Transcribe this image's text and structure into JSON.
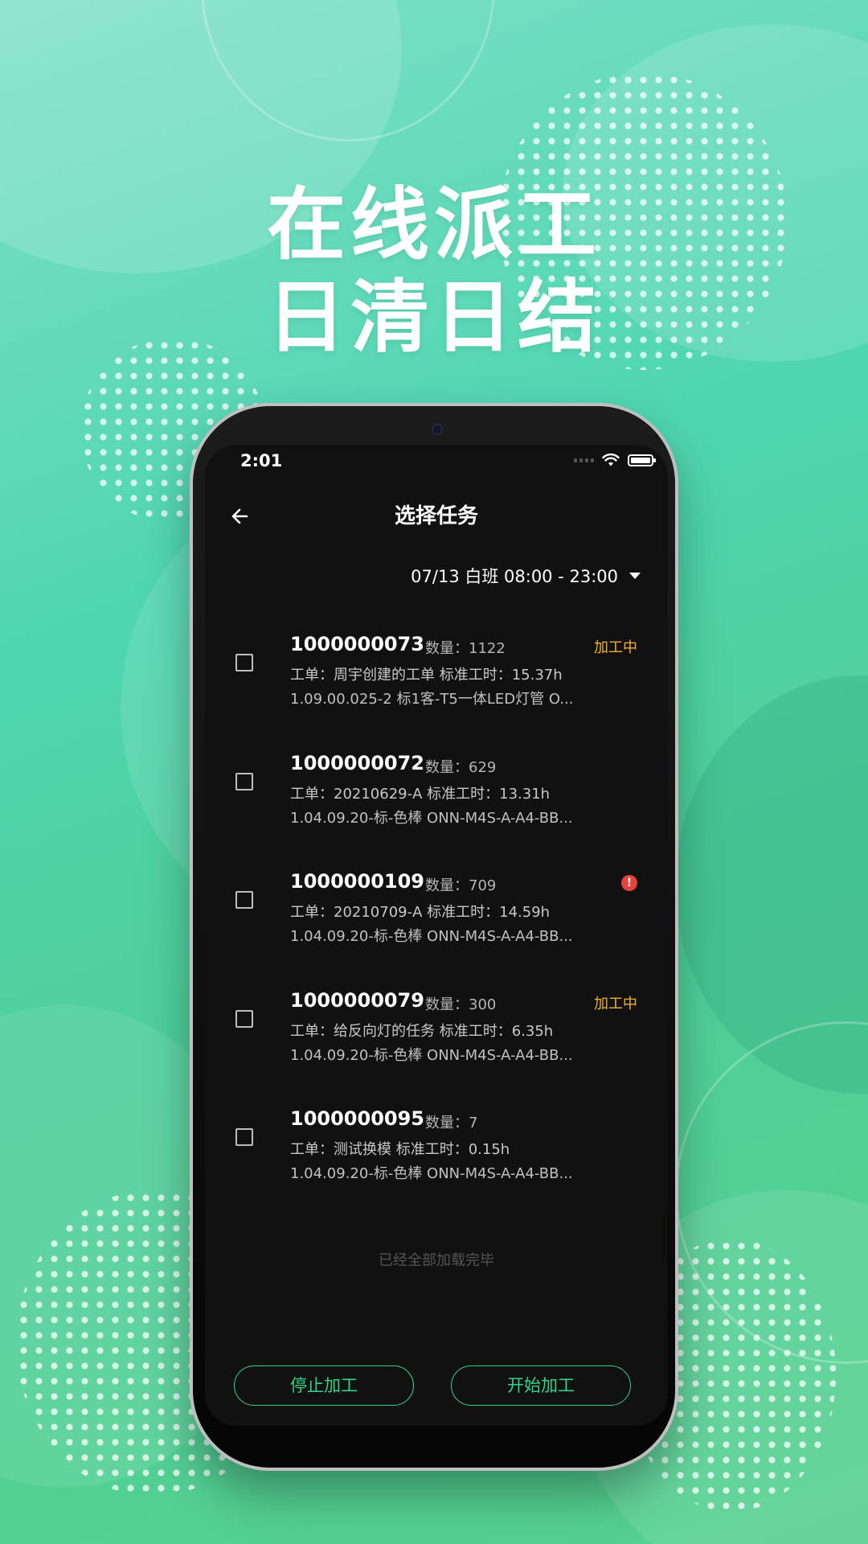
{
  "headline": {
    "line1": "在线派工",
    "line2": "日清日结"
  },
  "status_bar": {
    "time": "2:01"
  },
  "nav": {
    "title": "选择任务",
    "back_icon": "arrow-left-icon"
  },
  "shift_selector": {
    "value": "07/13 白班 08:00 - 23:00"
  },
  "tasks": [
    {
      "id": "1000000073",
      "qty_text": "数量：1122",
      "status": "加工中",
      "work_order": "工单：周宇创建的工单  标准工时：15.37h",
      "product": "1.09.00.025-2 标1客-T5一体LED灯管 O..."
    },
    {
      "id": "1000000072",
      "qty_text": "数量：629",
      "status": "",
      "work_order": "工单：20210629-A  标准工时：13.31h",
      "product": "1.04.09.20-标-色棒 ONN-M4S-A-A4-BB..."
    },
    {
      "id": "1000000109",
      "qty_text": "数量：709",
      "alert": "!",
      "work_order": "工单：20210709-A  标准工时：14.59h",
      "product": "1.04.09.20-标-色棒 ONN-M4S-A-A4-BB..."
    },
    {
      "id": "1000000079",
      "qty_text": "数量：300",
      "status": "加工中",
      "work_order": "工单：给反向灯的任务  标准工时：6.35h",
      "product": "1.04.09.20-标-色棒 ONN-M4S-A-A4-BB..."
    },
    {
      "id": "1000000095",
      "qty_text": "数量：7",
      "status": "",
      "work_order": "工单：测试换模  标准工时：0.15h",
      "product": "1.04.09.20-标-色棒 ONN-M4S-A-A4-BB..."
    }
  ],
  "list_end_text": "已经全部加载完毕",
  "buttons": {
    "stop": "停止加工",
    "start": "开始加工"
  },
  "colors": {
    "accent": "#2fd58c",
    "status_in_progress": "#f2b22f",
    "alert": "#e5433a",
    "screen_bg": "#111111"
  }
}
